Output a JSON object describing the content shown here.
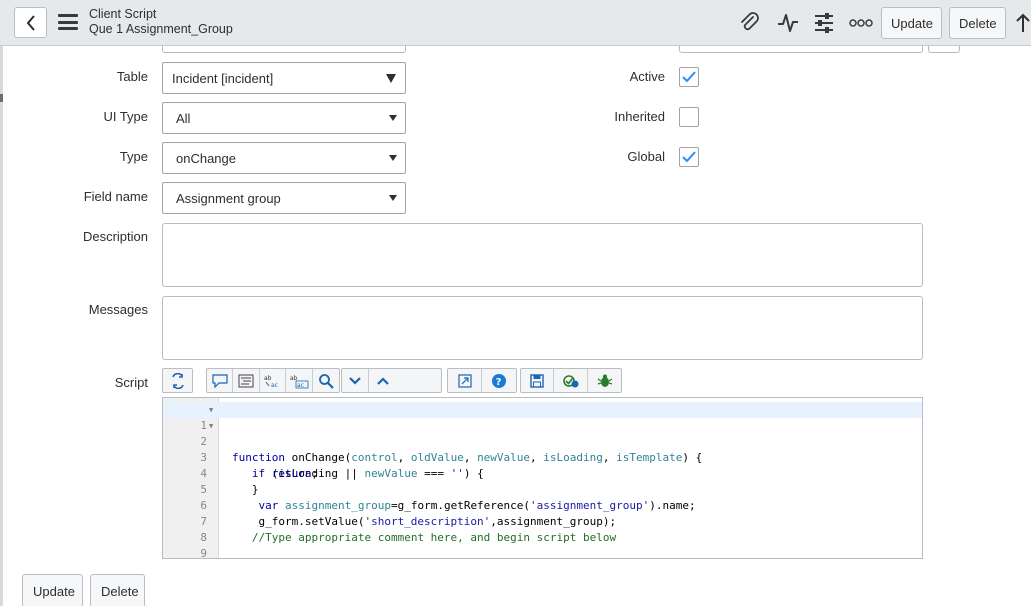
{
  "header": {
    "title": "Client Script",
    "subtitle": "Que 1 Assignment_Group",
    "update_label": "Update",
    "delete_label": "Delete"
  },
  "form": {
    "table": {
      "label": "Table",
      "value": "Incident [incident]"
    },
    "ui_type": {
      "label": "UI Type",
      "value": "All"
    },
    "type": {
      "label": "Type",
      "value": "onChange"
    },
    "field_name": {
      "label": "Field name",
      "value": "Assignment group"
    },
    "active": {
      "label": "Active",
      "checked": true
    },
    "inherited": {
      "label": "Inherited",
      "checked": false
    },
    "global": {
      "label": "Global",
      "checked": true
    },
    "description": {
      "label": "Description",
      "value": ""
    },
    "messages": {
      "label": "Messages",
      "value": ""
    },
    "script": {
      "label": "Script",
      "line_numbers": [
        "1",
        "2",
        "3",
        "4",
        "5",
        "6",
        "7",
        "8",
        "9"
      ]
    }
  },
  "footer": {
    "update_label": "Update",
    "delete_label": "Delete"
  },
  "colors": {
    "header_bg": "#e6e9eb",
    "check_color": "#278efc",
    "keyword": "#0000a2",
    "variable": "#318495",
    "string": "#1a1aa6",
    "comment": "#236e24"
  }
}
